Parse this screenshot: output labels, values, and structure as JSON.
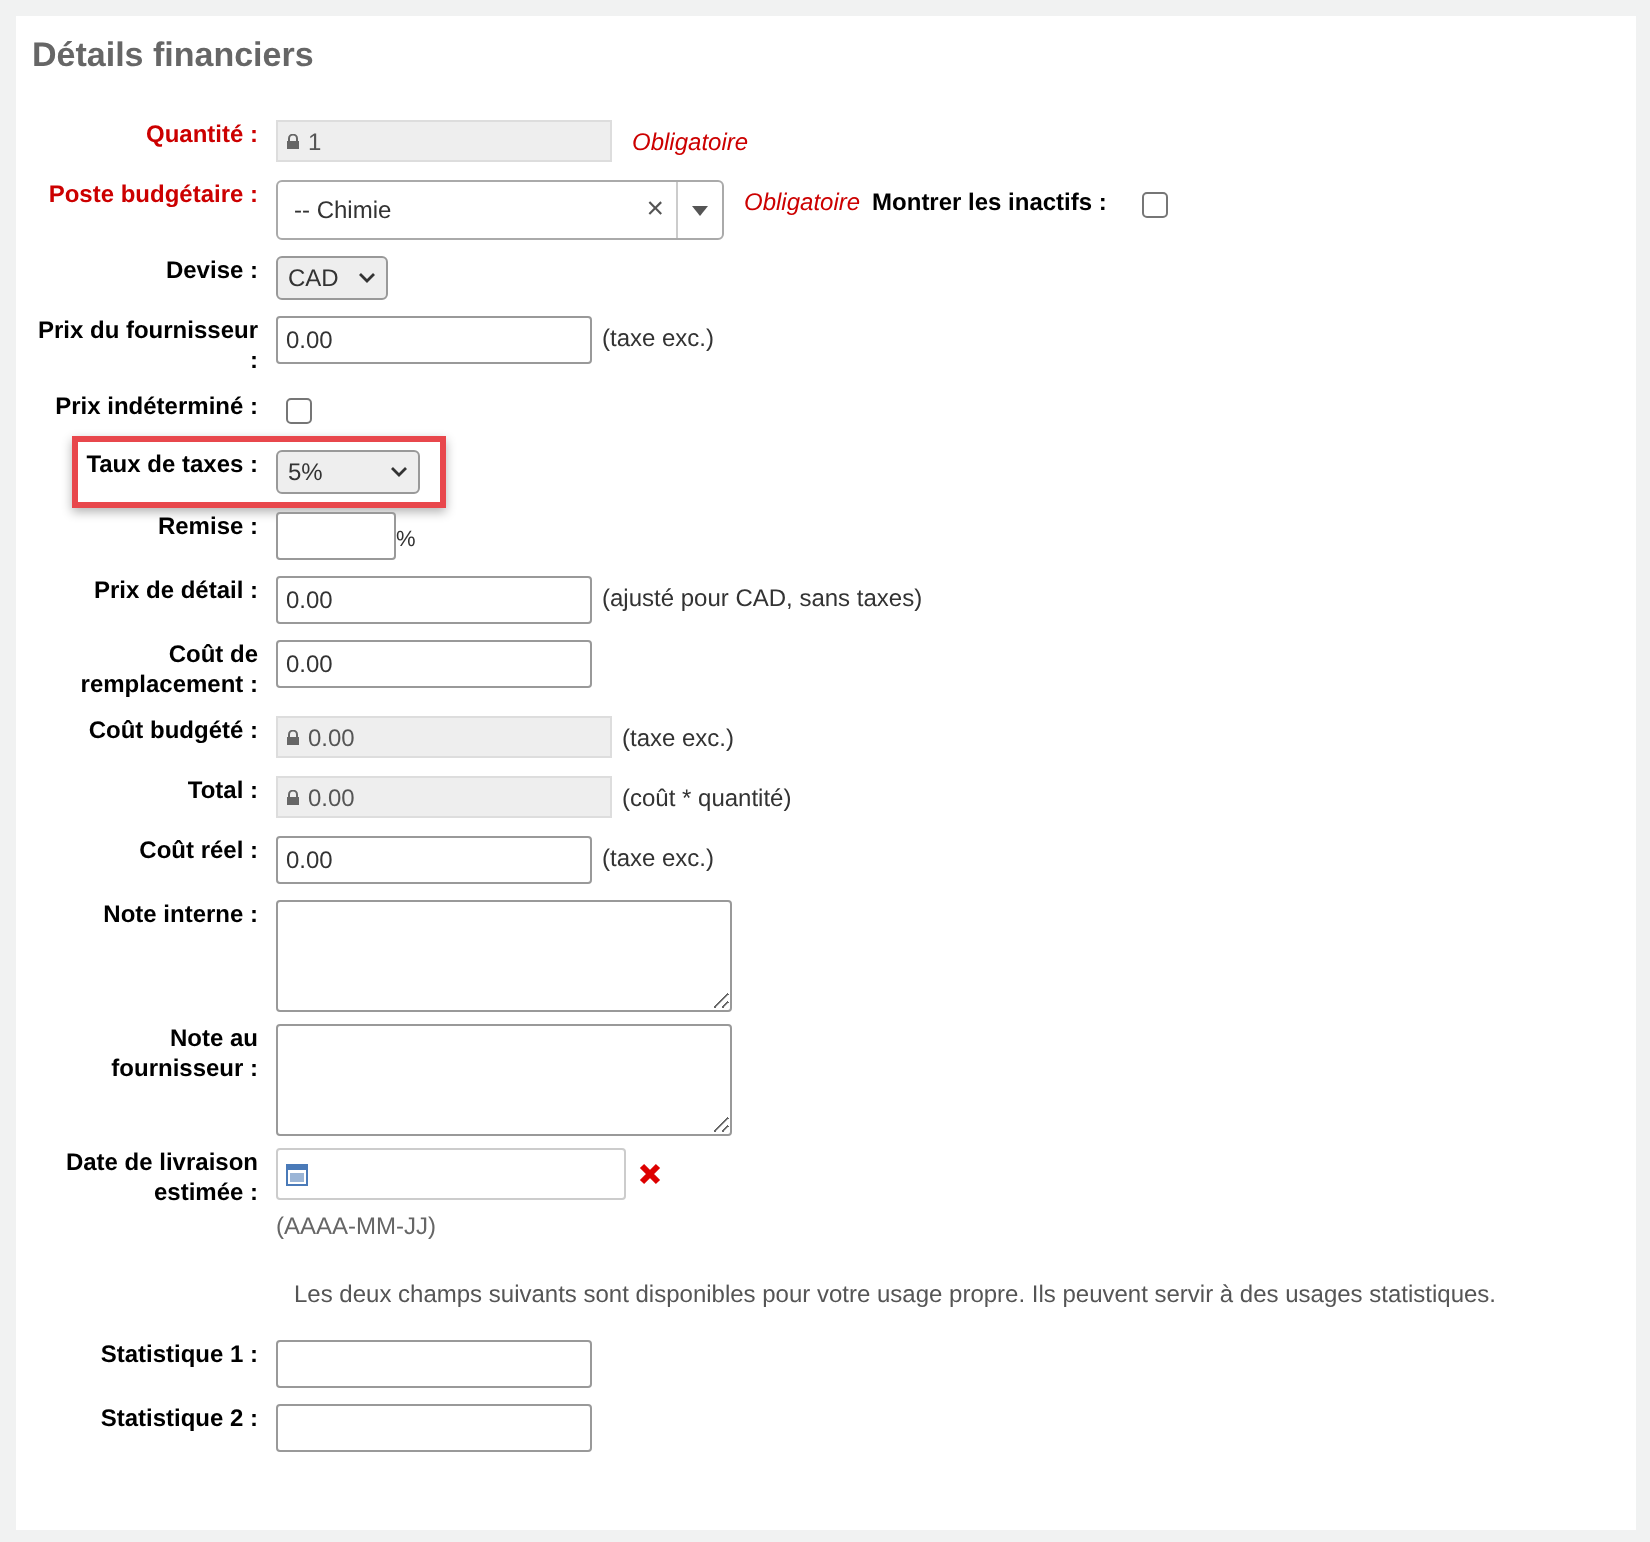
{
  "title": "Détails financiers",
  "fields": [
    {
      "kind": "locked",
      "label": "Quantité :",
      "required": true,
      "value": "1",
      "note": "Obligatoire"
    },
    {
      "kind": "combo",
      "label": "Poste budgétaire :",
      "required": true,
      "value": "-- Chimie",
      "clear": "×",
      "note": "Obligatoire",
      "extra": {
        "label": "Montrer les inactifs :",
        "checked": false
      }
    },
    {
      "kind": "select",
      "label": "Devise :",
      "required": false,
      "value": "CAD"
    },
    {
      "kind": "text",
      "label": "Prix du fournisseur :",
      "required": false,
      "value": "0.00",
      "note": "(taxe exc.)"
    },
    {
      "kind": "checkbox",
      "label": "Prix indéterminé :",
      "required": false,
      "checked": false
    },
    {
      "kind": "select",
      "label": "Taux de taxes :",
      "required": false,
      "value": "5%",
      "highlighted": true
    },
    {
      "kind": "short",
      "label": "Remise :",
      "required": false,
      "unit": "%"
    },
    {
      "kind": "text",
      "label": "Prix de détail :",
      "required": false,
      "value": "0.00",
      "note": "(ajusté pour CAD, sans taxes)"
    },
    {
      "kind": "text",
      "label": "Coût de remplacement :",
      "required": false,
      "value": "0.00"
    },
    {
      "kind": "locked",
      "label": "Coût budgété :",
      "required": false,
      "value": "0.00",
      "note": "(taxe exc.)"
    },
    {
      "kind": "locked",
      "label": "Total :",
      "required": false,
      "value": "0.00",
      "note": "(coût * quantité)"
    },
    {
      "kind": "text",
      "label": "Coût réel :",
      "required": false,
      "value": "0.00",
      "note": "(taxe exc.)"
    },
    {
      "kind": "textarea",
      "label": "Note interne :",
      "required": false
    },
    {
      "kind": "textarea",
      "label": "Note au fournisseur :",
      "required": false
    },
    {
      "kind": "date",
      "label": "Date de livraison estimée :",
      "required": false,
      "hint": "(AAAA-MM-JJ)"
    },
    {
      "kind": "info",
      "text": "Les deux champs suivants sont disponibles pour votre usage propre. Ils peuvent servir à des usages statistiques."
    },
    {
      "kind": "text",
      "label": "Statistique 1 :",
      "required": false
    },
    {
      "kind": "text",
      "label": "Statistique 2 :",
      "required": false
    }
  ]
}
